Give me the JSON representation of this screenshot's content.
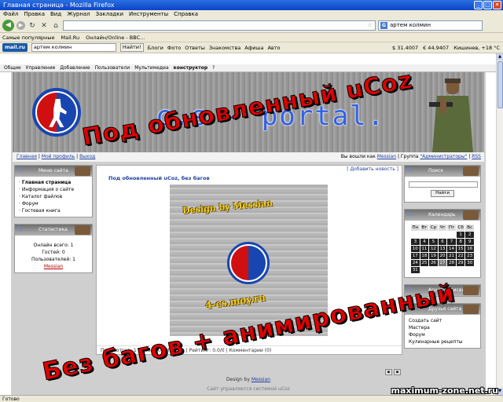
{
  "window": {
    "title": "Главная страница - Mozilla Firefox",
    "min": "_",
    "max": "□",
    "close": "✕"
  },
  "menu": [
    "Файл",
    "Правка",
    "Вид",
    "Журнал",
    "Закладки",
    "Инструменты",
    "Справка"
  ],
  "nav": {
    "url": "",
    "search": "артем колмин"
  },
  "bookmarks": [
    "Самые популярные",
    "Mail.Ru",
    "Онлайн/Online - BBC..."
  ],
  "mailru": {
    "logo": "mail.ru",
    "query": "артем колмин",
    "go": "Найти!",
    "items": [
      "Блоги",
      "Фото",
      "Ответы",
      "Знакомства",
      "Афиша",
      "Авто"
    ],
    "right": [
      "$ 31.4007",
      "€ 44.9407",
      "Кишинев, +18 °C"
    ]
  },
  "ucoz_bar": [
    "Общие",
    "Управление",
    "Добавление",
    "Пользователи",
    "Мультимедиа",
    "конструктор",
    "?"
  ],
  "site": {
    "title": "c.s - portal.",
    "crumbs": {
      "home": "Главная",
      "profile": "Мой профиль",
      "exit": "Выход",
      "right_prefix": "Вы вошли как",
      "user": "Messian",
      "group_prefix": "Группа",
      "group": "\"Администраторы\"",
      "rss": "RSS"
    },
    "left_blocks": [
      {
        "title": "Меню сайта",
        "items": [
          "Главная страница",
          "Информация о сайте",
          "Каталог файлов",
          "Форум",
          "Гостевая книга"
        ]
      },
      {
        "title": "Статистика",
        "lines": [
          "Онлайн всего: 1",
          "Гостей: 0",
          "Пользователей: 1"
        ],
        "user": "Messian"
      }
    ],
    "main": {
      "add": "[ Добавить новость ]",
      "post_title": "Под обновленный uCoz, без багов",
      "img_text1": "Design by Messian",
      "img_text2": "4-cs.moy.ru",
      "footer": "Просмотров: 1 | Добавил: Messian | Рейтинг: 0.0/0 | Комментарии (0)"
    },
    "right_blocks": [
      {
        "title": "Поиск",
        "button": "Найти"
      },
      {
        "title": "Календарь",
        "days": [
          "Пн",
          "Вт",
          "Ср",
          "Чт",
          "Пт",
          "Сб",
          "Вс"
        ],
        "dates": [
          "",
          "",
          "",
          "",
          "",
          "1",
          "2",
          "3",
          "4",
          "5",
          "6",
          "7",
          "8",
          "9",
          "10",
          "11",
          "12",
          "13",
          "14",
          "15",
          "16",
          "17",
          "18",
          "19",
          "20",
          "21",
          "22",
          "23",
          "24",
          "25",
          "26",
          "27",
          "28",
          "29",
          "30",
          "31"
        ],
        "today": "27"
      },
      {
        "title": "Архив записей"
      },
      {
        "title": "Друзья сайта",
        "items": [
          "Создать сайт",
          "Мастера",
          "Форум",
          "Кулинарные рецепты"
        ]
      }
    ],
    "footer": {
      "prefix": "Design by",
      "author": "Messian",
      "hosting": "Сайт управляется системой uCoz"
    }
  },
  "overlay": {
    "top": "Под обновленный uCoz",
    "bottom": "Без багов + анимированный",
    "watermark": "maximum-zone.net.ru"
  },
  "status": "Готово"
}
